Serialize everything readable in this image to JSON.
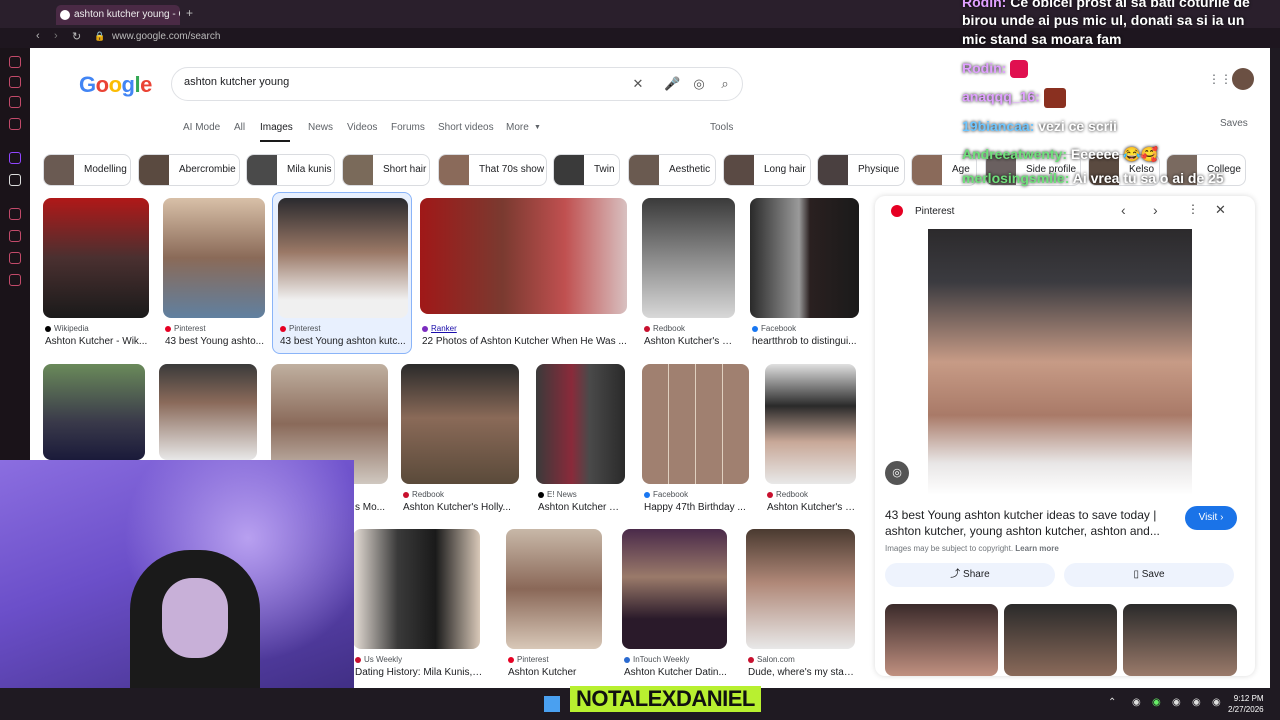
{
  "browser": {
    "tab_title": "ashton kutcher young - Go",
    "url": "www.google.com/search"
  },
  "google": {
    "logo": "Google",
    "query": "ashton kutcher young",
    "nav_tabs": [
      "AI Mode",
      "All",
      "Images",
      "News",
      "Videos",
      "Forums",
      "Short videos",
      "More"
    ],
    "active_tab": "Images",
    "tools": "Tools",
    "saves": "Saves"
  },
  "chips": [
    "Modelling",
    "Abercrombie",
    "Mila kunis",
    "Short hair",
    "That 70s show",
    "Twin",
    "Aesthetic",
    "Long hair",
    "Physique",
    "Age",
    "Side profile",
    "Kelso",
    "College"
  ],
  "results_row1": [
    {
      "source": "Wikipedia",
      "title": "Ashton Kutcher - Wik...",
      "color": "#000000"
    },
    {
      "source": "Pinterest",
      "title": "43 best Young ashto...",
      "color": "#e60023"
    },
    {
      "source": "Pinterest",
      "title": "43 best Young ashton kutc...",
      "color": "#e60023"
    },
    {
      "source": "Ranker",
      "title": "22 Photos of Ashton Kutcher When He Was ...",
      "color": "#7b2cbf"
    },
    {
      "source": "Redbook",
      "title": "Ashton Kutcher's H...",
      "color": "#c8102e"
    },
    {
      "source": "Facebook",
      "title": "heartthrob to distingui...",
      "color": "#1877f2"
    }
  ],
  "results_row2": [
    {
      "source": "Redbook",
      "title": "Ashton Kutcher's Holly...",
      "color": "#c8102e"
    },
    {
      "source": "E! News",
      "title": "Ashton Kutcher Th...",
      "color": "#000000"
    },
    {
      "source": "Facebook",
      "title": "Happy 47th Birthday ...",
      "color": "#1877f2"
    },
    {
      "source": "Redbook",
      "title": "Ashton Kutcher's H...",
      "color": "#c8102e"
    }
  ],
  "row2_partial_title": "s Mo...",
  "results_row3": [
    {
      "source": "Us Weekly",
      "title": "Dating History: Mila Kunis, D...",
      "color": "#c8102e"
    },
    {
      "source": "Pinterest",
      "title": "Ashton Kutcher",
      "color": "#e60023"
    },
    {
      "source": "InTouch Weekly",
      "title": "Ashton Kutcher Datin...",
      "color": "#2a6ad0"
    },
    {
      "source": "Salon.com",
      "title": "Dude, where's my star?...",
      "color": "#c8102e"
    }
  ],
  "panel": {
    "source": "Pinterest",
    "title": "43 best Young ashton kutcher ideas to save today | ashton kutcher, young ashton kutcher, ashton and...",
    "copyright": "Images may be subject to copyright.",
    "learn_more": "Learn more",
    "visit": "Visit",
    "share": "Share",
    "save": "Save"
  },
  "chat": [
    {
      "name": "Rodin:",
      "text": "Ce obicei prost ai sa bati coturile de"
    },
    {
      "name": "",
      "text": "birou unde ai pus mic ul, donati sa si ia un"
    },
    {
      "name": "",
      "text": "mic stand sa moara fam"
    },
    {
      "name": "Rodin:",
      "text": ""
    },
    {
      "name": "anaqqq_16:",
      "text": ""
    },
    {
      "name": "19biancaa:",
      "text": "vezi ce scrii"
    },
    {
      "name": "Andreeatwenty:",
      "text": "Eeeeee"
    },
    {
      "name": "merlosingsmile:",
      "text": "Ai vrea tu sa o ai de 25"
    }
  ],
  "stream": {
    "brand": "NOTALEXDANIEL"
  },
  "clock": {
    "time": "9:12 PM",
    "date": "2/27/2026"
  }
}
